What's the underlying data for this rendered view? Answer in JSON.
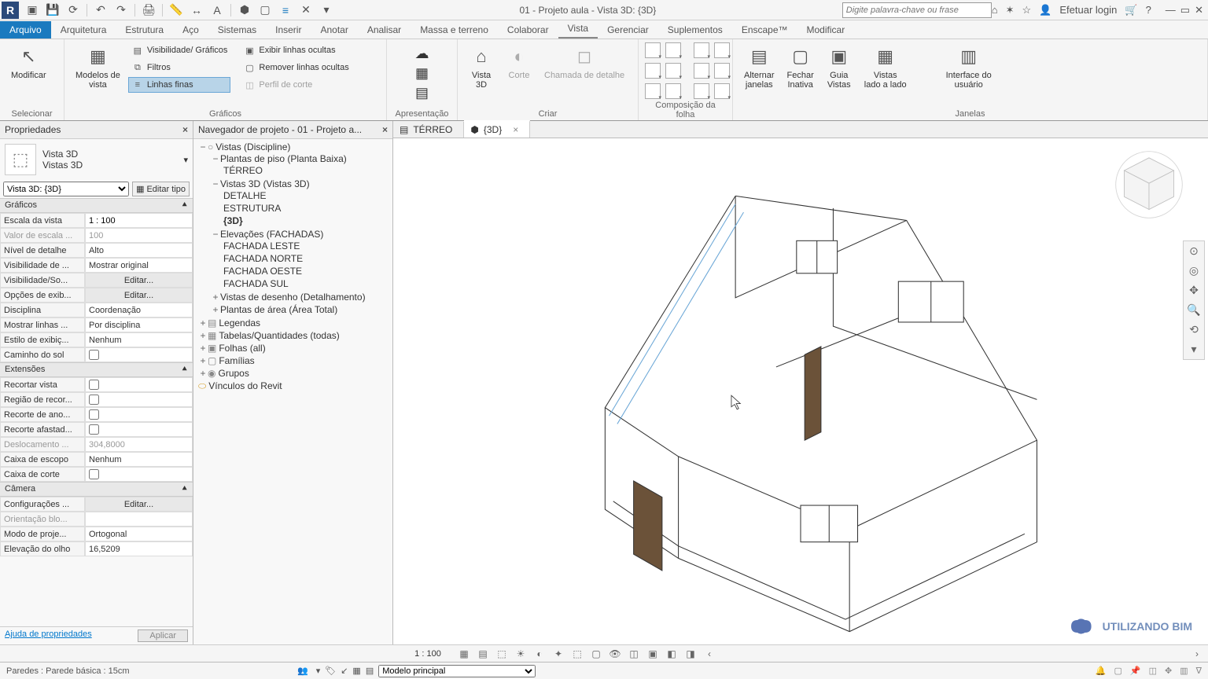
{
  "app": {
    "title": "01 - Projeto aula - Vista 3D: {3D}",
    "search_placeholder": "Digite palavra-chave ou frase",
    "login": "Efetuar login"
  },
  "ribbon": {
    "tabs": [
      "Arquivo",
      "Arquitetura",
      "Estrutura",
      "Aço",
      "Sistemas",
      "Inserir",
      "Anotar",
      "Analisar",
      "Massa e terreno",
      "Colaborar",
      "Vista",
      "Gerenciar",
      "Suplementos",
      "Enscape™",
      "Modificar"
    ],
    "active": "Vista",
    "file_tab": "Arquivo",
    "selecionar": "Selecionar",
    "modificar": "Modificar",
    "modelos_vista": "Modelos de\nvista",
    "visib_graf": "Visibilidade/ Gráficos",
    "filtros": "Filtros",
    "linhas_finas": "Linhas finas",
    "exibir_ocultas": "Exibir linhas ocultas",
    "remover_ocultas": "Remover linhas ocultas",
    "perfil_corte": "Perfil de corte",
    "graficos": "Gráficos",
    "apresentacao": "Apresentação",
    "vista3d": "Vista\n3D",
    "corte": "Corte",
    "chamada": "Chamada de detalhe",
    "criar": "Criar",
    "composicao": "Composição da folha",
    "alternar": "Alternar\njanelas",
    "fechar_inativa": "Fechar\nInativa",
    "guia_vistas": "Guia\nVistas",
    "vistas_lado": "Vistas\nlado a lado",
    "interface": "Interface do\nusuário",
    "janelas": "Janelas"
  },
  "properties": {
    "title": "Propriedades",
    "type_line1": "Vista 3D",
    "type_line2": "Vistas 3D",
    "view_selector": "Vista 3D: {3D}",
    "edit_type": "Editar tipo",
    "sections": {
      "graficos": "Gráficos",
      "extensoes": "Extensões",
      "camera": "Câmera"
    },
    "rows": {
      "escala": {
        "label": "Escala da vista",
        "value": "1 : 100"
      },
      "valor_escala": {
        "label": "Valor de escala ...",
        "value": "100"
      },
      "nivel_detalhe": {
        "label": "Nível de detalhe",
        "value": "Alto"
      },
      "visib_de": {
        "label": "Visibilidade de ...",
        "value": "Mostrar original"
      },
      "visib_so": {
        "label": "Visibilidade/So...",
        "value": "Editar..."
      },
      "opcoes_exib": {
        "label": "Opções de exib...",
        "value": "Editar..."
      },
      "disciplina": {
        "label": "Disciplina",
        "value": "Coordenação"
      },
      "mostrar_linhas": {
        "label": "Mostrar linhas ...",
        "value": "Por disciplina"
      },
      "estilo_exib": {
        "label": "Estilo de exibiç...",
        "value": "Nenhum"
      },
      "caminho_sol": {
        "label": "Caminho do sol",
        "value": ""
      },
      "recortar": {
        "label": "Recortar vista",
        "value": ""
      },
      "regiao_recor": {
        "label": "Região de recor...",
        "value": ""
      },
      "recorte_ano": {
        "label": "Recorte de ano...",
        "value": ""
      },
      "recorte_afast": {
        "label": "Recorte afastad...",
        "value": ""
      },
      "deslocamento": {
        "label": "Deslocamento ...",
        "value": "304,8000"
      },
      "caixa_escopo": {
        "label": "Caixa de escopo",
        "value": "Nenhum"
      },
      "caixa_corte": {
        "label": "Caixa de corte",
        "value": ""
      },
      "configuracoes": {
        "label": "Configurações ...",
        "value": "Editar..."
      },
      "orientacao": {
        "label": "Orientação blo...",
        "value": ""
      },
      "modo_proj": {
        "label": "Modo de proje...",
        "value": "Ortogonal"
      },
      "elevacao": {
        "label": "Elevação do olho",
        "value": "16,5209"
      }
    },
    "help": "Ajuda de propriedades",
    "apply": "Aplicar"
  },
  "browser": {
    "title": "Navegador de projeto - 01 - Projeto a...",
    "root": "Vistas (Discipline)",
    "plantas_piso": "Plantas de piso (Planta Baixa)",
    "terreo": "TÉRREO",
    "vistas3d": "Vistas 3D (Vistas 3D)",
    "detalhe": "DETALHE",
    "estrutura": "ESTRUTURA",
    "tresd": "{3D}",
    "elevacoes": "Elevações (FACHADAS)",
    "f_leste": "FACHADA LESTE",
    "f_norte": "FACHADA NORTE",
    "f_oeste": "FACHADA OESTE",
    "f_sul": "FACHADA SUL",
    "vistas_desenho": "Vistas de desenho (Detalhamento)",
    "plantas_area": "Plantas de área (Área Total)",
    "legendas": "Legendas",
    "tabelas": "Tabelas/Quantidades (todas)",
    "folhas": "Folhas (all)",
    "familias": "Famílias",
    "grupos": "Grupos",
    "vinculos": "Vínculos do Revit"
  },
  "view_tabs": {
    "tab1": "TÉRREO",
    "tab2": "{3D}"
  },
  "view_controls": {
    "scale": "1 : 100"
  },
  "statusbar": {
    "left": "Paredes : Parede básica : 15cm",
    "model": "Modelo principal"
  },
  "watermark": "UTILIZANDO BIM"
}
